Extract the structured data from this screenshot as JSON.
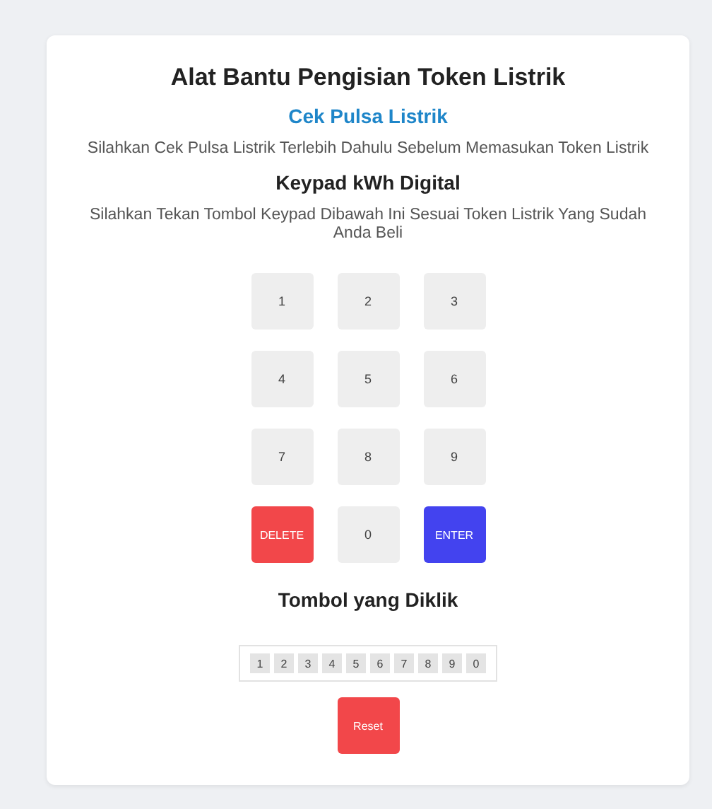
{
  "title": "Alat Bantu Pengisian Token Listrik",
  "link": "Cek Pulsa Listrik",
  "intro": "Silahkan Cek Pulsa Listrik Terlebih Dahulu Sebelum Memasukan Token Listrik",
  "keypad_title": "Keypad kWh Digital",
  "keypad_hint": "Silahkan Tekan Tombol Keypad Dibawah Ini Sesuai Token Listrik Yang Sudah Anda Beli",
  "keys": [
    {
      "label": "1",
      "kind": "digit"
    },
    {
      "label": "2",
      "kind": "digit"
    },
    {
      "label": "3",
      "kind": "digit"
    },
    {
      "label": "4",
      "kind": "digit"
    },
    {
      "label": "5",
      "kind": "digit"
    },
    {
      "label": "6",
      "kind": "digit"
    },
    {
      "label": "7",
      "kind": "digit"
    },
    {
      "label": "8",
      "kind": "digit"
    },
    {
      "label": "9",
      "kind": "digit"
    },
    {
      "label": "DELETE",
      "kind": "delete"
    },
    {
      "label": "0",
      "kind": "digit"
    },
    {
      "label": "ENTER",
      "kind": "enter"
    }
  ],
  "clicked_title": "Tombol yang Diklik",
  "clicked": [
    "1",
    "2",
    "3",
    "4",
    "5",
    "6",
    "7",
    "8",
    "9",
    "0"
  ],
  "reset_button": "Reset"
}
